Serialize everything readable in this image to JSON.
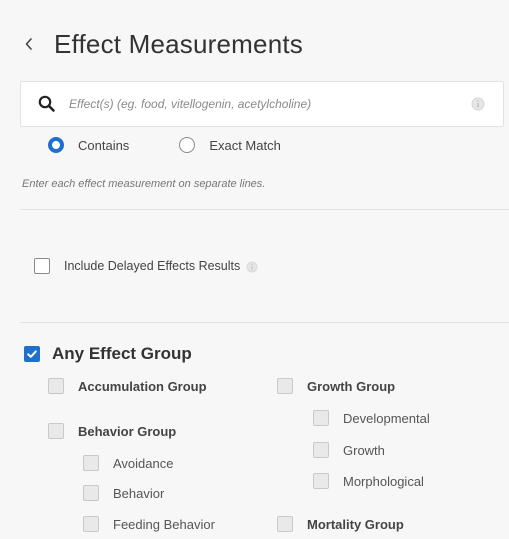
{
  "header": {
    "title": "Effect Measurements",
    "back_icon": "chevron-left-icon"
  },
  "search": {
    "placeholder": "Effect(s) (eg. food, vitellogenin, acetylcholine)",
    "value": "",
    "icon": "search-icon",
    "info_icon": "info-icon"
  },
  "match": {
    "contains_label": "Contains",
    "exact_label": "Exact Match",
    "selected": "contains"
  },
  "hint": "Enter each effect measurement on separate lines.",
  "delayed": {
    "label": "Include Delayed Effects Results",
    "checked": false
  },
  "groups": {
    "any_label": "Any Effect Group",
    "any_checked": true,
    "accumulation": "Accumulation Group",
    "behavior": "Behavior Group",
    "behavior_items": [
      "Avoidance",
      "Behavior",
      "Feeding Behavior"
    ],
    "growth": "Growth Group",
    "growth_items": [
      "Developmental",
      "Growth",
      "Morphological"
    ],
    "mortality": "Mortality Group"
  },
  "colors": {
    "accent": "#1f6fcf"
  }
}
